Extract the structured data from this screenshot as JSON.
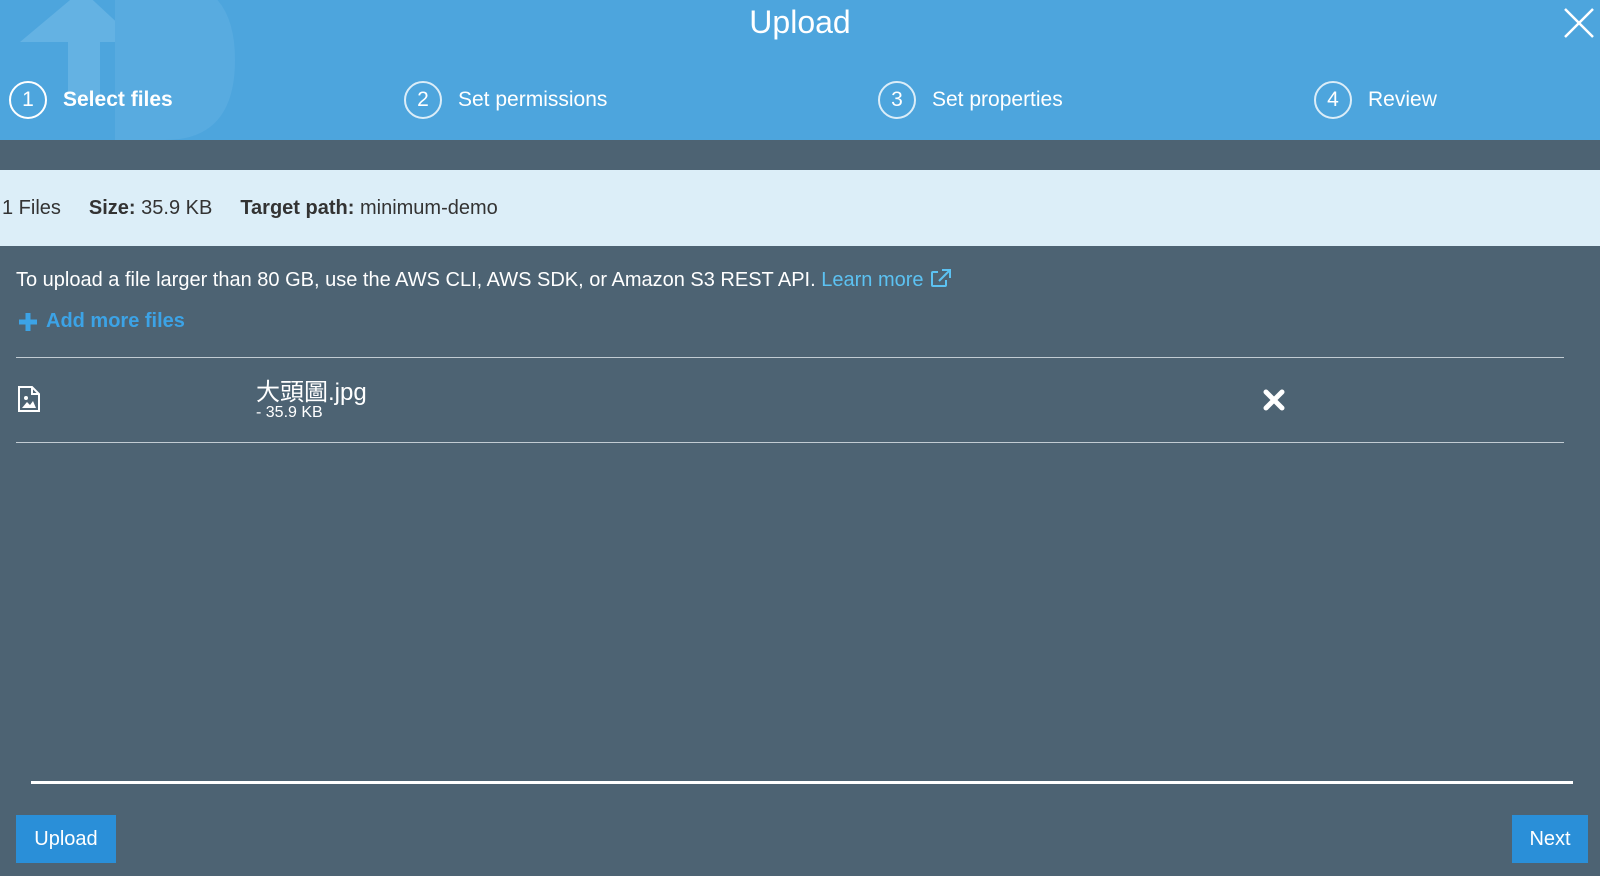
{
  "header": {
    "title": "Upload",
    "close_icon": "close-icon",
    "steps": [
      {
        "number": "1",
        "label": "Select files",
        "active": true
      },
      {
        "number": "2",
        "label": "Set permissions",
        "active": false
      },
      {
        "number": "3",
        "label": "Set properties",
        "active": false
      },
      {
        "number": "4",
        "label": "Review",
        "active": false
      }
    ]
  },
  "summary": {
    "files": "1 Files",
    "size_label": "Size:",
    "size_value": "35.9 KB",
    "path_label": "Target path:",
    "path_value": "minimum-demo"
  },
  "notice": {
    "text": "To upload a file larger than 80 GB, use the AWS CLI, AWS SDK, or Amazon S3 REST API.",
    "link": "Learn more",
    "link_icon": "external-link-icon"
  },
  "add_files": {
    "label": "Add more files",
    "icon": "plus-icon"
  },
  "files": [
    {
      "name": "大頭圖.jpg",
      "size": "- 35.9 KB",
      "icon": "image-file-icon",
      "remove_icon": "close-x-icon"
    }
  ],
  "footer": {
    "upload_label": "Upload",
    "next_label": "Next"
  },
  "colors": {
    "header_bg": "#4da5dd",
    "body_bg": "#4d6373",
    "summary_bg": "#dceef8",
    "link": "#5cc2f2",
    "button": "#2a8fd8"
  }
}
